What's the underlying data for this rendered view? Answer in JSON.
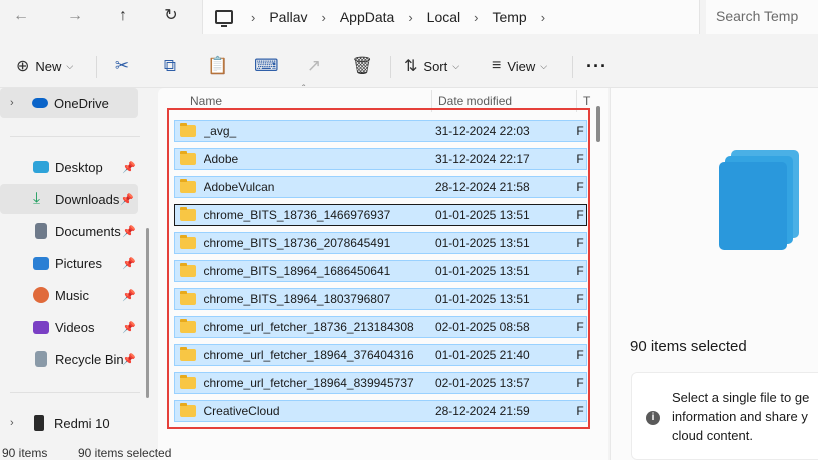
{
  "nav": {
    "back_icon": "arrow-left-icon",
    "forward_icon": "arrow-right-icon",
    "up_icon": "arrow-up-icon",
    "refresh_icon": "refresh-icon"
  },
  "breadcrumb": [
    "Pallav",
    "AppData",
    "Local",
    "Temp"
  ],
  "search": {
    "placeholder": "Search Temp"
  },
  "toolbar": {
    "new_label": "New",
    "sort_label": "Sort",
    "view_label": "View"
  },
  "sidebar": {
    "items": [
      {
        "label": "OneDrive",
        "icon": "cloud-icon",
        "color": "#0a64c9"
      },
      {
        "label": "Desktop",
        "icon": "desktop-icon",
        "color": "#2ea3d9"
      },
      {
        "label": "Downloads",
        "icon": "download-icon",
        "color": "#1e9e5e"
      },
      {
        "label": "Documents",
        "icon": "document-icon",
        "color": "#6e7a8a"
      },
      {
        "label": "Pictures",
        "icon": "picture-icon",
        "color": "#2a7fd4"
      },
      {
        "label": "Music",
        "icon": "music-icon",
        "color": "#e06a3a"
      },
      {
        "label": "Videos",
        "icon": "video-icon",
        "color": "#7a3fc4"
      },
      {
        "label": "Recycle Bin",
        "icon": "recycle-bin-icon",
        "color": "#8a9aa8"
      },
      {
        "label": "Redmi 10",
        "icon": "phone-icon",
        "color": "#2a2a2a"
      }
    ]
  },
  "columns": {
    "name": "Name",
    "date": "Date modified",
    "type": "T"
  },
  "files": [
    {
      "name": "_avg_",
      "date": "31-12-2024 22:03",
      "type": "F"
    },
    {
      "name": "Adobe",
      "date": "31-12-2024 22:17",
      "type": "F"
    },
    {
      "name": "AdobeVulcan",
      "date": "28-12-2024 21:58",
      "type": "F"
    },
    {
      "name": "chrome_BITS_18736_1466976937",
      "date": "01-01-2025 13:51",
      "type": "F"
    },
    {
      "name": "chrome_BITS_18736_2078645491",
      "date": "01-01-2025 13:51",
      "type": "F"
    },
    {
      "name": "chrome_BITS_18964_1686450641",
      "date": "01-01-2025 13:51",
      "type": "F"
    },
    {
      "name": "chrome_BITS_18964_1803796807",
      "date": "01-01-2025 13:51",
      "type": "F"
    },
    {
      "name": "chrome_url_fetcher_18736_213184308",
      "date": "02-01-2025 08:58",
      "type": "F"
    },
    {
      "name": "chrome_url_fetcher_18964_376404316",
      "date": "01-01-2025 21:40",
      "type": "F"
    },
    {
      "name": "chrome_url_fetcher_18964_839945737",
      "date": "02-01-2025 13:57",
      "type": "F"
    },
    {
      "name": "CreativeCloud",
      "date": "28-12-2024 21:59",
      "type": "F"
    }
  ],
  "details": {
    "selection": "90 items selected",
    "info": "Select a single file to ge information and share y cloud content."
  },
  "status": {
    "count": "90 items",
    "selected": "90 items selected"
  },
  "colors": {
    "selection_fill": "#cce8ff",
    "selection_border": "#99d1ff",
    "highlight_box": "#e5403a",
    "folder": "#f8c644"
  }
}
